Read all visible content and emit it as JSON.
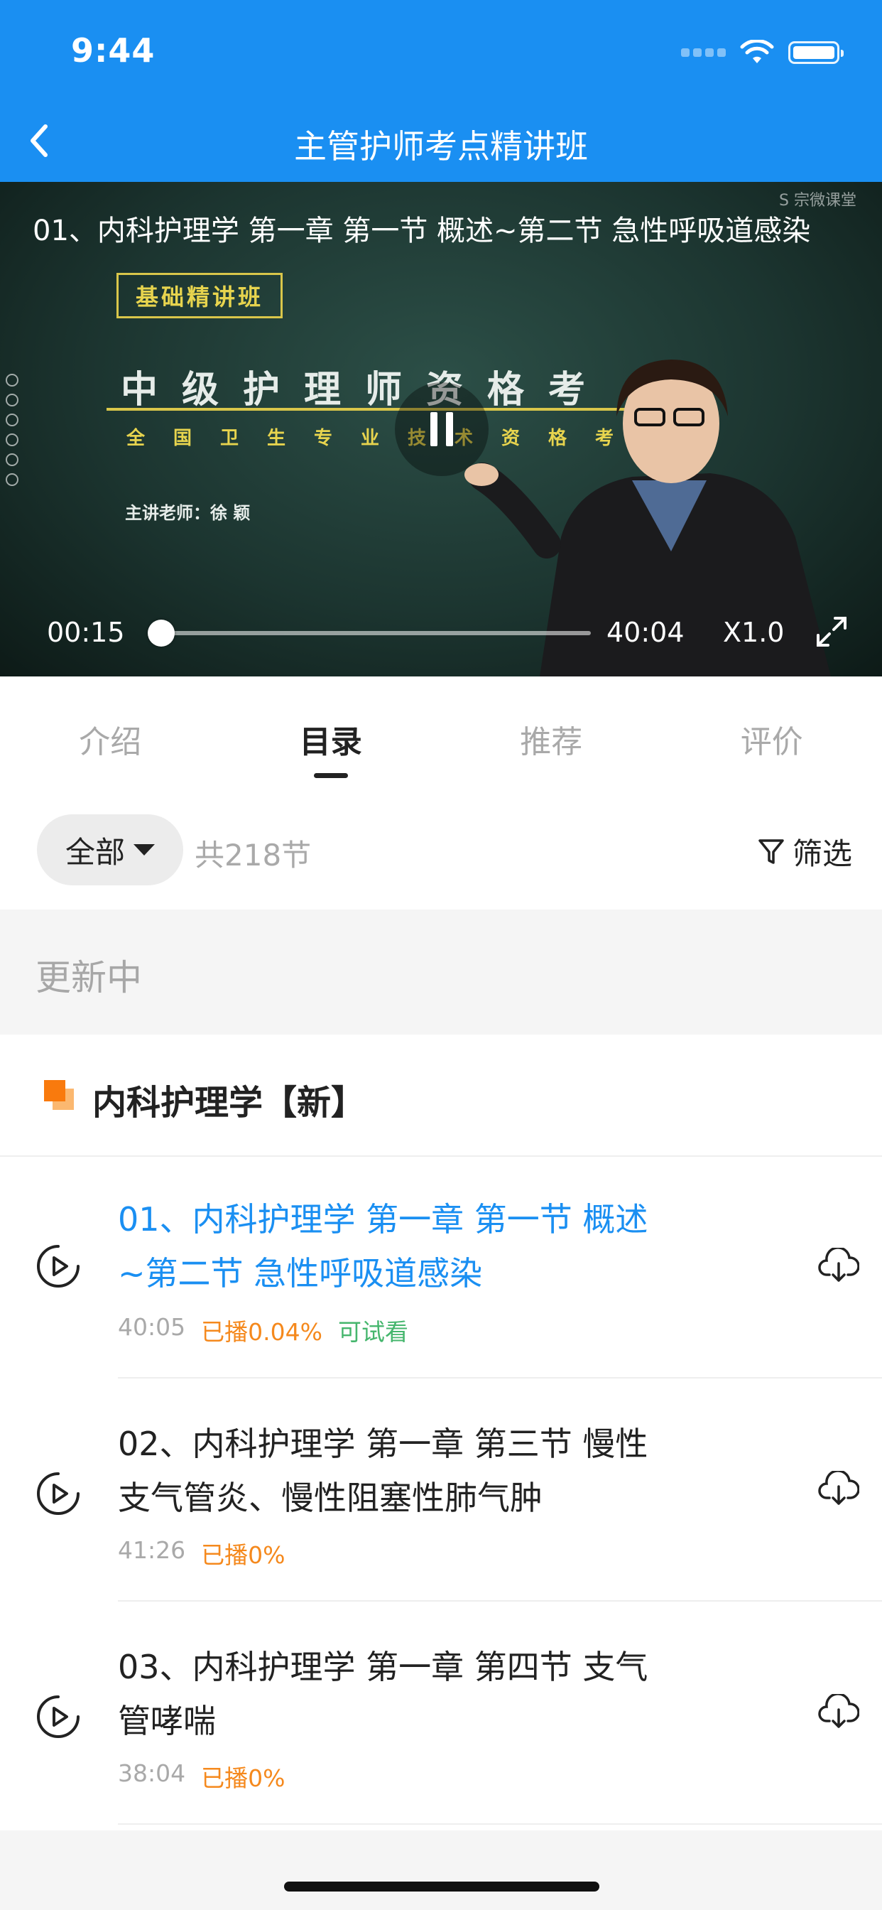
{
  "status_bar": {
    "time": "9:44"
  },
  "nav": {
    "title": "主管护师考点精讲班"
  },
  "video": {
    "title": "01、内科护理学 第一章 第一节 概述~第二节 急性呼吸道感染",
    "watermark": "S 宗微课堂",
    "board_tag": "基础精讲班",
    "board_title": "中级护理师资格考",
    "board_subtitle": "全国卫生专业技术资格考",
    "board_teacher": "主讲老师：徐 颖",
    "current_time": "00:15",
    "total_time": "40:04",
    "speed": "X1.0",
    "progress": 0.006
  },
  "tabs": [
    {
      "label": "介绍",
      "active": false
    },
    {
      "label": "目录",
      "active": true
    },
    {
      "label": "推荐",
      "active": false
    },
    {
      "label": "评价",
      "active": false
    }
  ],
  "filter": {
    "dropdown_label": "全部",
    "total": "共218节",
    "filter_label": "筛选"
  },
  "updating_label": "更新中",
  "section": {
    "title": "内科护理学【新】"
  },
  "lessons": [
    {
      "title": "01、内科护理学 第一章 第一节 概述~第二节 急性呼吸道感染",
      "line1": "01、内科护理学 第一章 第一节 概述",
      "line2": "~第二节 急性呼吸道感染",
      "duration": "40:05",
      "played": "已播0.04%",
      "trial": "可试看",
      "current": true
    },
    {
      "line1": "02、内科护理学 第一章 第三节 慢性",
      "line2": "支气管炎、慢性阻塞性肺气肿",
      "duration": "41:26",
      "played": "已播0%",
      "current": false
    },
    {
      "line1": "03、内科护理学 第一章 第四节 支气",
      "line2": "管哮喘",
      "duration": "38:04",
      "played": "已播0%",
      "current": false
    }
  ],
  "colors": {
    "brand_blue": "#1a8ff2",
    "played_orange": "#f5891d",
    "trial_green": "#45b66d"
  }
}
